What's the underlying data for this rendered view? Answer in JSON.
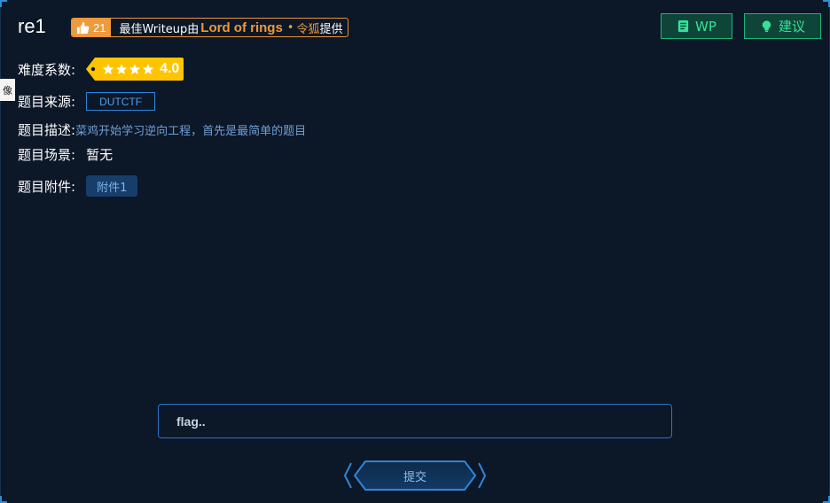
{
  "challenge": {
    "title": "re1",
    "writeup_badge": {
      "like_count": "21",
      "prefix": "最佳Writeup由",
      "author": "Lord of rings",
      "separator": "•",
      "provider": "令狐",
      "suffix": "提供"
    },
    "header_buttons": {
      "wp_label": "WP",
      "suggest_label": "建议"
    },
    "side_tab_label": "像",
    "difficulty": {
      "label": "难度系数:",
      "stars": 4,
      "rating": "4.0"
    },
    "source": {
      "label": "题目来源:",
      "value": "DUTCTF"
    },
    "description": {
      "label": "题目描述:",
      "value": "菜鸡开始学习逆向工程，首先是最简单的题目"
    },
    "scene": {
      "label": "题目场景:",
      "value": "暂无"
    },
    "attachments": {
      "label": "题目附件:",
      "items": [
        "附件1"
      ]
    }
  },
  "flag_form": {
    "placeholder": "flag..",
    "value": "",
    "submit_label": "提交"
  },
  "colors": {
    "background": "#0c1727",
    "accent_green": "#33e39a",
    "accent_orange": "#f0983a",
    "accent_blue": "#2d86dd",
    "star_gold": "#ffc400"
  }
}
